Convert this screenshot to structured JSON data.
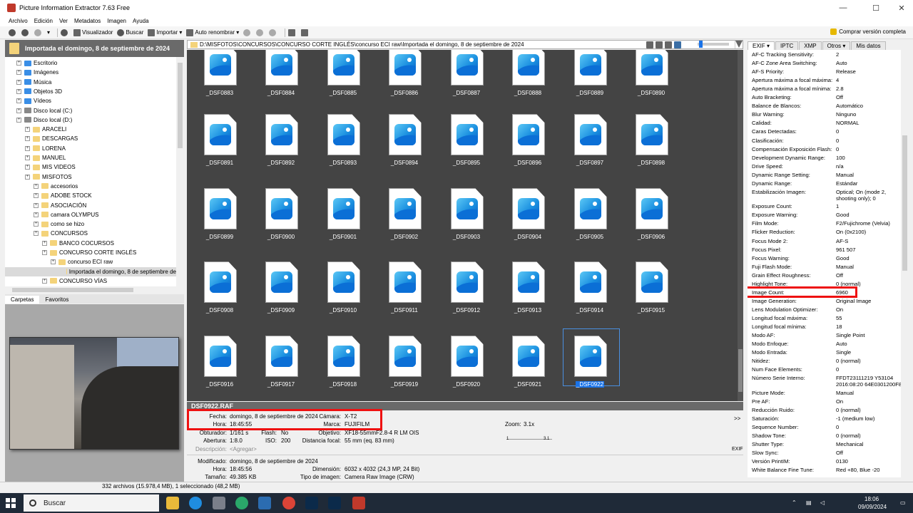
{
  "window": {
    "title": "Picture Information Extractor 7.63 Free",
    "controls": [
      "—",
      "☐",
      "✕"
    ]
  },
  "menu": [
    "Archivo",
    "Edición",
    "Ver",
    "Metadatos",
    "Imagen",
    "Ayuda"
  ],
  "toolbar": {
    "viewer": "Visualizador",
    "search": "Buscar",
    "import": "Importar",
    "rename": "Auto renombrar",
    "buy": "Comprar versión completa"
  },
  "folder_header": "Importada el domingo, 8 de septiembre de 2024",
  "tree": [
    {
      "label": "Escritorio",
      "icon": "blue",
      "indent": 0
    },
    {
      "label": "Imágenes",
      "icon": "blue",
      "indent": 0
    },
    {
      "label": "Música",
      "icon": "blue",
      "indent": 0
    },
    {
      "label": "Objetos 3D",
      "icon": "blue",
      "indent": 0
    },
    {
      "label": "Vídeos",
      "icon": "blue",
      "indent": 0
    },
    {
      "label": "Disco local (C:)",
      "icon": "drive",
      "indent": 0
    },
    {
      "label": "Disco local (D:)",
      "icon": "drive",
      "indent": 0
    },
    {
      "label": "ARACELI",
      "icon": "folder",
      "indent": 1
    },
    {
      "label": "DESCARGAS",
      "icon": "folder",
      "indent": 1
    },
    {
      "label": "LORENA",
      "icon": "folder",
      "indent": 1
    },
    {
      "label": "MANUEL",
      "icon": "folder",
      "indent": 1
    },
    {
      "label": "MIS VIDEOS",
      "icon": "folder",
      "indent": 1
    },
    {
      "label": "MISFOTOS",
      "icon": "folder",
      "indent": 1
    },
    {
      "label": "accesorios",
      "icon": "folder",
      "indent": 2
    },
    {
      "label": "ADOBE STOCK",
      "icon": "folder",
      "indent": 2
    },
    {
      "label": "ASOCIACIÓN",
      "icon": "folder",
      "indent": 2
    },
    {
      "label": "camara OLYMPUS",
      "icon": "folder",
      "indent": 2
    },
    {
      "label": "como se hizo",
      "icon": "folder",
      "indent": 2
    },
    {
      "label": "CONCURSOS",
      "icon": "folder",
      "indent": 2
    },
    {
      "label": "BANCO COCURSOS",
      "icon": "folder",
      "indent": 3
    },
    {
      "label": "CONCURSO CORTE INGLÉS",
      "icon": "folder",
      "indent": 3
    },
    {
      "label": "concurso ECI raw",
      "icon": "folder",
      "indent": 4
    },
    {
      "label": "Importada el domingo, 8 de septiembre de",
      "icon": "folder",
      "indent": 5,
      "selected": true
    },
    {
      "label": "CONCURSO VÍAS",
      "icon": "folder",
      "indent": 3
    }
  ],
  "left_tabs": [
    "Carpetas",
    "Favoritos"
  ],
  "path": "D:\\MISFOTOS\\CONCURSOS\\CONCURSO CORTE INGLÉS\\concurso ECI raw\\Importada el domingo, 8 de septiembre de 2024",
  "thumbnails": [
    [
      "_DSF0883",
      "_DSF0884",
      "_DSF0885",
      "_DSF0886",
      "_DSF0887",
      "_DSF0888",
      "_DSF0889",
      "_DSF0890"
    ],
    [
      "_DSF0891",
      "_DSF0892",
      "_DSF0893",
      "_DSF0894",
      "_DSF0895",
      "_DSF0896",
      "_DSF0897",
      "_DSF0898"
    ],
    [
      "_DSF0899",
      "_DSF0900",
      "_DSF0901",
      "_DSF0902",
      "_DSF0903",
      "_DSF0904",
      "_DSF0905",
      "_DSF0906"
    ],
    [
      "_DSF0908",
      "_DSF0909",
      "_DSF0910",
      "_DSF0911",
      "_DSF0912",
      "_DSF0913",
      "_DSF0914",
      "_DSF0915"
    ],
    [
      "_DSF0916",
      "_DSF0917",
      "_DSF0918",
      "_DSF0919",
      "_DSF0920",
      "_DSF0921",
      "_DSF0922"
    ]
  ],
  "selected_thumbnail": "_DSF0922",
  "info": {
    "filename": "DSF0922.RAF",
    "fecha_label": "Fecha:",
    "fecha": "domingo, 8 de septiembre de 2024",
    "hora_label": "Hora:",
    "hora": "18:45:55",
    "camara_label": "Cámara:",
    "camara": "X-T2",
    "marca_label": "Marca:",
    "marca": "FUJIFILM",
    "zoom_label": "Zoom:",
    "zoom": "3.1x",
    "zoom_min": "1",
    "zoom_max": "3.1",
    "more": ">>",
    "obturador_label": "Obturador:",
    "obturador": "1/161 s",
    "flash_label": "Flash:",
    "flash": "No",
    "objetivo_label": "Objetivo:",
    "objetivo": "XF18-55mmF2.8-4 R LM OIS",
    "apertura_label": "Abertura:",
    "apertura": "1:8.0",
    "iso_label": "ISO:",
    "iso": "200",
    "distancia_label": "Distancia focal:",
    "distancia": "55 mm (eq. 83 mm)",
    "descripcion_label": "Descripción:",
    "descripcion": "<Agregar>",
    "exif_tag": "EXIF",
    "modificado_label": "Modificado:",
    "modificado": "domingo, 8 de septiembre de 2024",
    "hora2_label": "Hora:",
    "hora2": "18:45:56",
    "tamano_label": "Tamaño:",
    "tamano": "49.385 KB",
    "dimension_label": "Dimensión:",
    "dimension": "6032 x 4032 (24,3 MP, 24 Bit)",
    "tipo_label": "Tipo de imagen:",
    "tipo": "Camera Raw Image (CRW)"
  },
  "status": "332 archivos (15.978,4 MB), 1 seleccionado (48,2 MB)",
  "right_tabs": [
    "EXIF ▾",
    "IPTC",
    "XMP",
    "Otros ▾",
    "Mis datos"
  ],
  "exif": [
    {
      "k": "AF-C Tracking Sensitivity:",
      "v": "2"
    },
    {
      "k": "AF-C Zone Area Switching:",
      "v": "Auto"
    },
    {
      "k": "AF-S Priority:",
      "v": "Release"
    },
    {
      "k": "Apertura máxima a focal máxima:",
      "v": "4"
    },
    {
      "k": "Apertura máxima a focal mínima:",
      "v": "2.8"
    },
    {
      "k": "Auto Bracketing:",
      "v": "Off"
    },
    {
      "k": "Balance de Blancos:",
      "v": "Automático"
    },
    {
      "k": "Blur Warning:",
      "v": "Ninguno"
    },
    {
      "k": "Calidad:",
      "v": "NORMAL"
    },
    {
      "k": "Caras Detectadas:",
      "v": "0"
    },
    {
      "k": "Clasificación:",
      "v": "0"
    },
    {
      "k": "Compensación Exposición Flash:",
      "v": "0"
    },
    {
      "k": "Development Dynamic Range:",
      "v": "100"
    },
    {
      "k": "Drive Speed:",
      "v": "n/a"
    },
    {
      "k": "Dynamic Range Setting:",
      "v": "Manual"
    },
    {
      "k": "Dynamic Range:",
      "v": "Estándar"
    },
    {
      "k": "Estabilización Imagen:",
      "v": "Optical; On (mode 2,",
      "v2": "shooting only); 0"
    },
    {
      "k": "Exposure Count:",
      "v": "1"
    },
    {
      "k": "Exposure Warning:",
      "v": "Good"
    },
    {
      "k": "Film Mode:",
      "v": "F2/Fujichrome (Velvia)"
    },
    {
      "k": "Flicker Reduction:",
      "v": "On (0x2100)"
    },
    {
      "k": "Focus Mode 2:",
      "v": "AF-S"
    },
    {
      "k": "Focus Pixel:",
      "v": "961 507"
    },
    {
      "k": "Focus Warning:",
      "v": "Good"
    },
    {
      "k": "Fuji Flash Mode:",
      "v": "Manual"
    },
    {
      "k": "Grain Effect Roughness:",
      "v": "Off"
    },
    {
      "k": "Highlight Tone:",
      "v": "0 (normal)"
    },
    {
      "k": "Image Count:",
      "v": "6960"
    },
    {
      "k": "Image Generation:",
      "v": "Original Image"
    },
    {
      "k": "Lens Modulation Optimizer:",
      "v": "On"
    },
    {
      "k": "Longitud focal máxima:",
      "v": "55"
    },
    {
      "k": "Longitud focal mínima:",
      "v": "18"
    },
    {
      "k": "Modo AF:",
      "v": "Single Point"
    },
    {
      "k": "Modo Enfoque:",
      "v": "Auto"
    },
    {
      "k": "Modo Entrada:",
      "v": "Single"
    },
    {
      "k": "Nitidez:",
      "v": "0 (normal)"
    },
    {
      "k": "Num Face Elements:",
      "v": "0"
    },
    {
      "k": "Número Serie Interno:",
      "v": "FFDT23111219     Y53104",
      "v2": "2016:08:20 64E0301200F8"
    },
    {
      "k": "Picture Mode:",
      "v": "Manual"
    },
    {
      "k": "Pre AF:",
      "v": "On"
    },
    {
      "k": "Reducción Ruido:",
      "v": "0 (normal)"
    },
    {
      "k": "Saturación:",
      "v": "-1 (medium low)"
    },
    {
      "k": "Sequence Number:",
      "v": "0"
    },
    {
      "k": "Shadow Tone:",
      "v": "0 (normal)"
    },
    {
      "k": "Shutter Type:",
      "v": "Mechanical"
    },
    {
      "k": "Slow Sync:",
      "v": "Off"
    },
    {
      "k": "Versión PrintIM:",
      "v": "0130"
    },
    {
      "k": "White Balance Fine Tune:",
      "v": "Red +80, Blue -20"
    }
  ],
  "taskbar": {
    "search_placeholder": "Buscar",
    "time": "18:06",
    "date": "09/09/2024"
  }
}
